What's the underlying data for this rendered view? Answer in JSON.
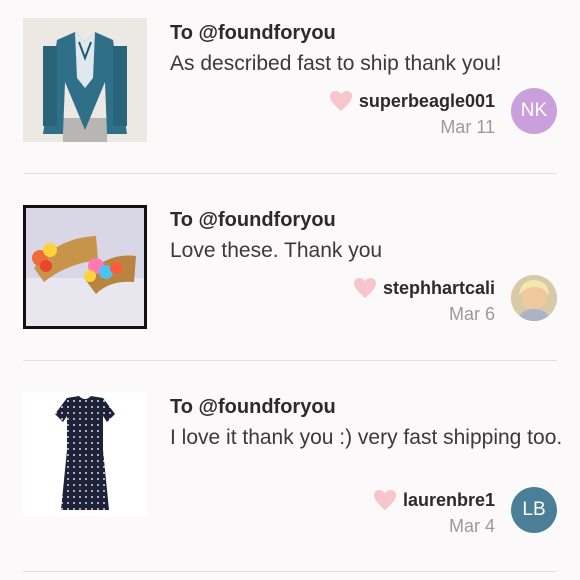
{
  "reviews": [
    {
      "to": "To @foundforyou",
      "message": "As described fast to ship thank you!",
      "username": "superbeagle001",
      "date": "Mar 11",
      "avatar_initials": "NK",
      "avatar_color": "#c9a0dc",
      "thumb_icon": "teal-blazer-photo"
    },
    {
      "to": "To @foundforyou",
      "message": "Love these. Thank you",
      "username": "stephhartcali",
      "date": "Mar 6",
      "avatar_initials": "",
      "avatar_color": "#e8d8b8",
      "thumb_icon": "flower-wedge-sandals-photo"
    },
    {
      "to": "To @foundforyou",
      "message": "I love it thank you :) very fast shipping too.",
      "username": "laurenbre1",
      "date": "Mar 4",
      "avatar_initials": "LB",
      "avatar_color": "#4a7f97",
      "thumb_icon": "polka-dot-dress-photo"
    }
  ],
  "colors": {
    "heart": "#f7c6cc",
    "divider": "#e2dfe1",
    "muted": "#9a9a9a"
  }
}
